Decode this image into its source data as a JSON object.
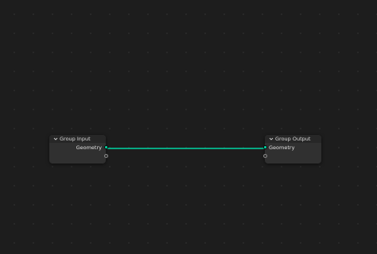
{
  "nodes": {
    "group_input": {
      "title": "Group Input",
      "sockets": [
        "Geometry"
      ]
    },
    "group_output": {
      "title": "Group Output",
      "sockets": [
        "Geometry"
      ]
    }
  },
  "colors": {
    "background": "#1d1d1d",
    "node_body": "#303030",
    "node_header": "#272727",
    "geometry_socket": "#00d6a3",
    "link": "#00d6a3"
  },
  "icons": {
    "collapse": "chevron-down-icon"
  }
}
